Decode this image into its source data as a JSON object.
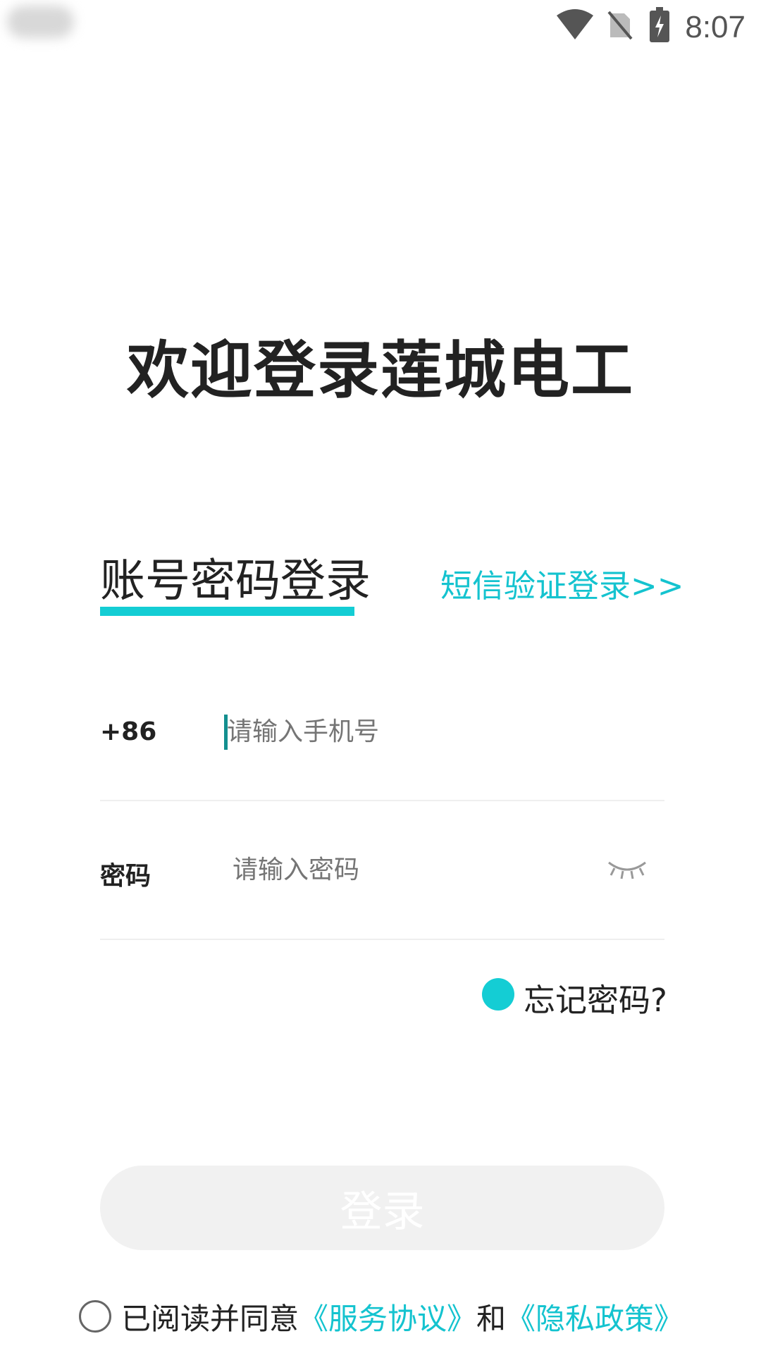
{
  "status_bar": {
    "time": "8:07",
    "icons": [
      "wifi-icon",
      "no-sim-icon",
      "battery-charging-icon"
    ]
  },
  "title": "欢迎登录莲城电工",
  "tabs": {
    "active_label": "账号密码登录",
    "sms_login_label": "短信验证登录>>"
  },
  "phone_field": {
    "prefix": "+86",
    "placeholder": "请输入手机号",
    "value": ""
  },
  "password_field": {
    "label": "密码",
    "placeholder": "请输入密码",
    "value": "",
    "visibility_icon": "eye-closed-icon"
  },
  "forgot_password": "忘记密码?",
  "login_button": "登录",
  "agreement": {
    "prefix": "已阅读并同意",
    "service_link": "《服务协议》",
    "and": "和",
    "privacy_link": "《隐私政策》"
  },
  "colors": {
    "accent": "#14cdd4",
    "link": "#14c3cf",
    "button_disabled_bg": "#f1f1f1"
  }
}
